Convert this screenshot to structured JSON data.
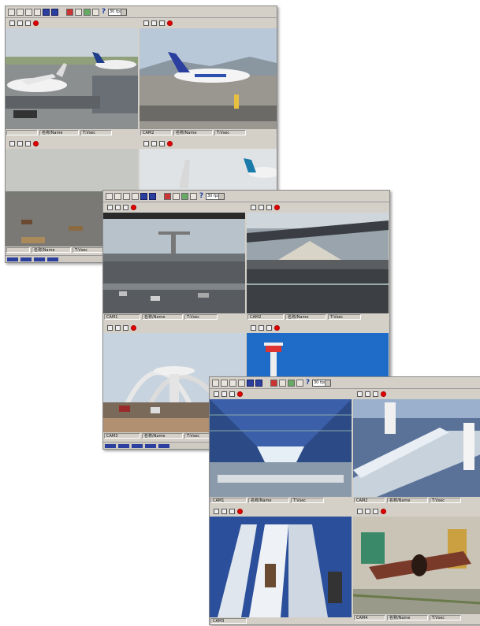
{
  "windows": [
    {
      "id": "airport",
      "speed": "30 fps",
      "panes": [
        {
          "cam": "",
          "name": "名称/Name",
          "time": "T:Vsec",
          "scene": "aircraft-apron"
        },
        {
          "cam": "CAM2",
          "name": "名称/Name",
          "time": "T:Vsec",
          "scene": "airliner-taxiway"
        },
        {
          "cam": "",
          "name": "名称/Name",
          "time": "T:Vsec",
          "scene": "runway-vehicles"
        },
        {
          "cam": "",
          "name": "",
          "time": "",
          "scene": "tail-fin"
        }
      ]
    },
    {
      "id": "highway",
      "speed": "30 fps",
      "panes": [
        {
          "cam": "CAM1",
          "name": "名称/Name",
          "time": "T:Vsec",
          "scene": "highway-interchange"
        },
        {
          "cam": "CAM2",
          "name": "名称/Name",
          "time": "T:Vsec",
          "scene": "terminal-canopy"
        },
        {
          "cam": "CAM3",
          "name": "名称/Name",
          "time": "T:Vsec",
          "scene": "theme-building"
        },
        {
          "cam": "",
          "name": "",
          "time": "",
          "scene": "control-tower"
        }
      ]
    },
    {
      "id": "factory",
      "speed": "30 fps",
      "panes": [
        {
          "cam": "CAM1",
          "name": "名称/Name",
          "time": "T:Vsec",
          "scene": "factory-hall"
        },
        {
          "cam": "CAM2",
          "name": "名称/Name",
          "time": "T:Vsec",
          "scene": "pipe-conveyor"
        },
        {
          "cam": "CAM3",
          "name": "",
          "time": "",
          "scene": "pipe-stack"
        },
        {
          "cam": "CAM4",
          "name": "名称/Name",
          "time": "T:Vsec",
          "scene": "steel-machinery"
        }
      ]
    }
  ],
  "colors": {
    "chrome": "#d4d0c8",
    "record": "#e00000",
    "toolbar_blue": "#2a3f9e"
  }
}
